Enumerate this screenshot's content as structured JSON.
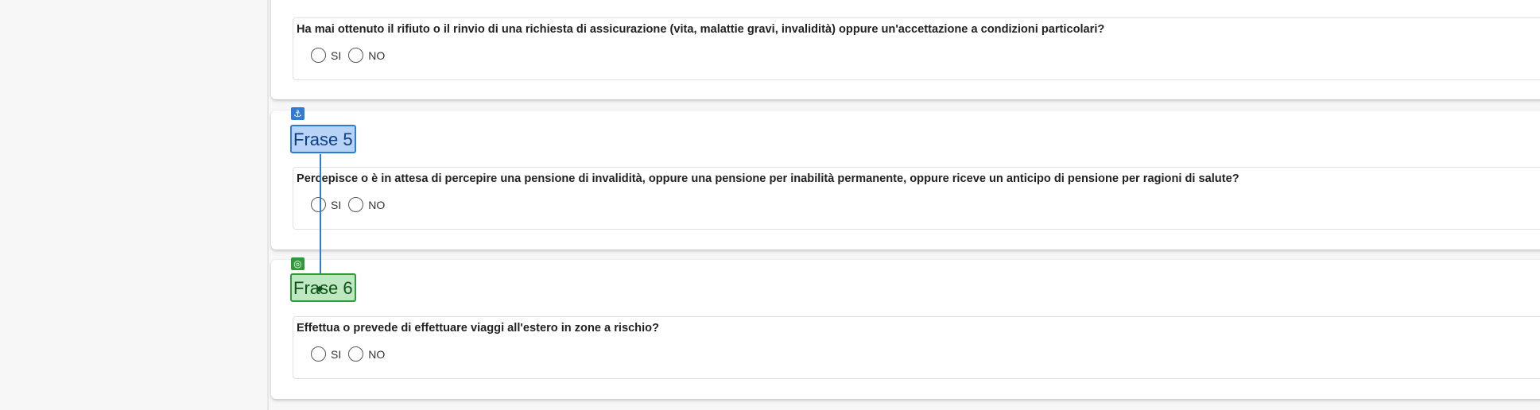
{
  "questions": [
    {
      "text": "Ha mai ottenuto il rifiuto o il rinvio di una richiesta di assicurazione (vita, malattie gravi, invalidità) oppure un'accettazione a condizioni particolari?",
      "options": [
        "SI",
        "NO"
      ]
    },
    {
      "frase_label": "Frase 5",
      "frase_icon": "anchor-icon",
      "text": "Percepisce o è in attesa di percepire una pensione di invalidità, oppure una pensione per inabilità permanente, oppure riceve un anticipo di pensione per ragioni di salute?",
      "options": [
        "SI",
        "NO"
      ]
    },
    {
      "frase_label": "Frase 6",
      "frase_icon": "target-icon",
      "text": "Effettua o prevede di effettuare viaggi all'estero in zone a rischio?",
      "options": [
        "SI",
        "NO"
      ]
    }
  ],
  "icons": {
    "anchor": "⚓",
    "target": "◎",
    "move": "⬥"
  },
  "colors": {
    "link_blue": "#2f7bd6",
    "link_green": "#2f9a3a",
    "blue_fill": "#b7d3f6",
    "green_fill": "#bfe7c2"
  }
}
